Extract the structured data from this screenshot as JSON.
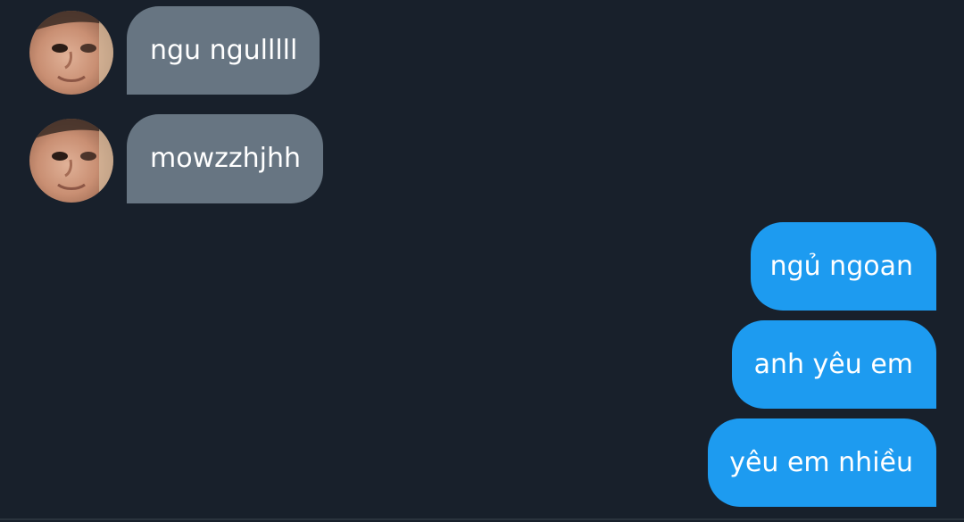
{
  "messages": [
    {
      "direction": "incoming",
      "text": "ngu ngulllll",
      "has_avatar": true
    },
    {
      "direction": "incoming",
      "text": "mowzzhjhh",
      "has_avatar": true
    },
    {
      "direction": "outgoing",
      "text": "ngủ ngoan"
    },
    {
      "direction": "outgoing",
      "text": "anh yêu em"
    },
    {
      "direction": "outgoing",
      "text": "yêu em nhiều"
    }
  ],
  "colors": {
    "background": "#18202b",
    "incoming_bubble": "#677582",
    "outgoing_bubble": "#1d9bf0",
    "text": "#ffffff"
  }
}
